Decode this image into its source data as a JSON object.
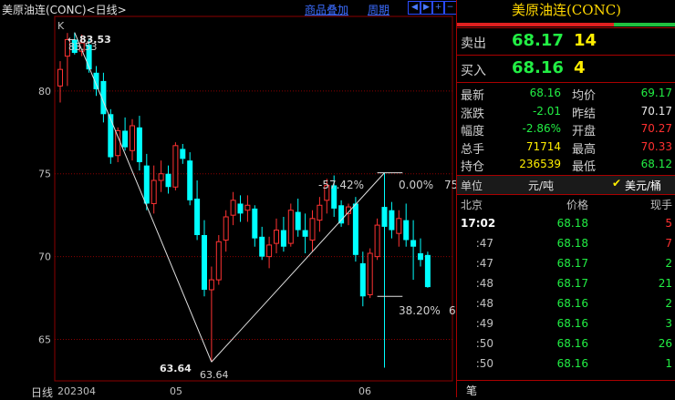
{
  "topbar": {
    "title": "美原油连(CONC)<日线>",
    "overlay_link": "商品叠加",
    "period_link": "周期",
    "buttons": [
      "arrow-left-icon",
      "arrow-right-icon",
      "plus-icon",
      "minus-icon"
    ]
  },
  "chart_marker": "K",
  "bottom_labels": {
    "period": "日线",
    "dates": [
      "202304",
      "05",
      "06"
    ]
  },
  "chart_data": {
    "type": "candlestick",
    "ylim": [
      62.5,
      84.5
    ],
    "yticks": [
      65,
      70,
      75,
      80
    ],
    "candles": [
      {
        "o": 80.3,
        "h": 81.8,
        "l": 79.3,
        "c": 81.3,
        "dir": "up"
      },
      {
        "o": 82.1,
        "h": 83.5,
        "l": 80.3,
        "c": 83.1,
        "dir": "up"
      },
      {
        "o": 83.1,
        "h": 83.53,
        "l": 82.2,
        "c": 82.3,
        "dir": "down"
      },
      {
        "o": 82.4,
        "h": 83.4,
        "l": 82.1,
        "c": 82.9,
        "dir": "up"
      },
      {
        "o": 82.8,
        "h": 83.1,
        "l": 81.1,
        "c": 81.3,
        "dir": "down"
      },
      {
        "o": 81.1,
        "h": 81.5,
        "l": 79.7,
        "c": 80.1,
        "dir": "down"
      },
      {
        "o": 80.6,
        "h": 81.1,
        "l": 78.1,
        "c": 78.6,
        "dir": "down"
      },
      {
        "o": 78.6,
        "h": 78.9,
        "l": 75.6,
        "c": 76.0,
        "dir": "down"
      },
      {
        "o": 76.1,
        "h": 77.8,
        "l": 75.7,
        "c": 77.6,
        "dir": "up"
      },
      {
        "o": 77.6,
        "h": 78.4,
        "l": 76.4,
        "c": 76.6,
        "dir": "down"
      },
      {
        "o": 76.4,
        "h": 78.3,
        "l": 75.8,
        "c": 77.9,
        "dir": "up"
      },
      {
        "o": 77.8,
        "h": 78.5,
        "l": 75.2,
        "c": 75.7,
        "dir": "down"
      },
      {
        "o": 75.5,
        "h": 76.2,
        "l": 72.8,
        "c": 73.2,
        "dir": "down"
      },
      {
        "o": 73.2,
        "h": 75.5,
        "l": 72.6,
        "c": 74.6,
        "dir": "up"
      },
      {
        "o": 74.6,
        "h": 75.8,
        "l": 73.9,
        "c": 75.0,
        "dir": "up"
      },
      {
        "o": 75.0,
        "h": 75.5,
        "l": 73.8,
        "c": 74.2,
        "dir": "down"
      },
      {
        "o": 74.2,
        "h": 76.9,
        "l": 74.0,
        "c": 76.7,
        "dir": "up"
      },
      {
        "o": 76.5,
        "h": 76.8,
        "l": 75.6,
        "c": 75.9,
        "dir": "down"
      },
      {
        "o": 75.8,
        "h": 76.3,
        "l": 73.1,
        "c": 73.4,
        "dir": "down"
      },
      {
        "o": 73.5,
        "h": 74.6,
        "l": 71.0,
        "c": 71.3,
        "dir": "down"
      },
      {
        "o": 71.3,
        "h": 72.2,
        "l": 67.6,
        "c": 68.0,
        "dir": "down"
      },
      {
        "o": 68.0,
        "h": 69.4,
        "l": 63.64,
        "c": 68.6,
        "dir": "up"
      },
      {
        "o": 68.6,
        "h": 71.3,
        "l": 68.3,
        "c": 70.9,
        "dir": "up"
      },
      {
        "o": 71.0,
        "h": 72.8,
        "l": 70.3,
        "c": 72.4,
        "dir": "up"
      },
      {
        "o": 72.5,
        "h": 73.9,
        "l": 71.9,
        "c": 73.4,
        "dir": "up"
      },
      {
        "o": 73.2,
        "h": 73.7,
        "l": 72.1,
        "c": 72.6,
        "dir": "down"
      },
      {
        "o": 72.8,
        "h": 73.7,
        "l": 72.1,
        "c": 73.1,
        "dir": "up"
      },
      {
        "o": 72.9,
        "h": 73.1,
        "l": 70.6,
        "c": 71.1,
        "dir": "down"
      },
      {
        "o": 71.2,
        "h": 71.8,
        "l": 69.8,
        "c": 70.0,
        "dir": "down"
      },
      {
        "o": 70.0,
        "h": 71.2,
        "l": 69.3,
        "c": 70.7,
        "dir": "up"
      },
      {
        "o": 70.8,
        "h": 72.3,
        "l": 70.2,
        "c": 71.6,
        "dir": "up"
      },
      {
        "o": 71.6,
        "h": 72.4,
        "l": 70.3,
        "c": 70.6,
        "dir": "down"
      },
      {
        "o": 70.8,
        "h": 73.2,
        "l": 70.6,
        "c": 72.8,
        "dir": "up"
      },
      {
        "o": 72.7,
        "h": 73.5,
        "l": 71.2,
        "c": 71.6,
        "dir": "down"
      },
      {
        "o": 71.6,
        "h": 72.6,
        "l": 70.2,
        "c": 71.2,
        "dir": "down"
      },
      {
        "o": 71.0,
        "h": 72.8,
        "l": 70.3,
        "c": 72.3,
        "dir": "up"
      },
      {
        "o": 72.2,
        "h": 73.6,
        "l": 71.5,
        "c": 73.1,
        "dir": "up"
      },
      {
        "o": 73.4,
        "h": 74.7,
        "l": 72.6,
        "c": 74.3,
        "dir": "up"
      },
      {
        "o": 74.3,
        "h": 74.9,
        "l": 72.4,
        "c": 72.9,
        "dir": "down"
      },
      {
        "o": 73.1,
        "h": 73.4,
        "l": 71.8,
        "c": 72.0,
        "dir": "down"
      },
      {
        "o": 72.6,
        "h": 73.2,
        "l": 71.9,
        "c": 73.0,
        "dir": "up"
      },
      {
        "o": 73.2,
        "h": 73.6,
        "l": 69.7,
        "c": 70.1,
        "dir": "down"
      },
      {
        "o": 69.6,
        "h": 70.3,
        "l": 67.0,
        "c": 67.6,
        "dir": "down"
      },
      {
        "o": 67.7,
        "h": 70.5,
        "l": 67.5,
        "c": 70.2,
        "dir": "up"
      },
      {
        "o": 70.0,
        "h": 72.3,
        "l": 69.8,
        "c": 71.9,
        "dir": "up"
      },
      {
        "o": 71.8,
        "h": 75.06,
        "l": 63.3,
        "c": 73.0,
        "dir": "down"
      },
      {
        "o": 72.8,
        "h": 73.3,
        "l": 71.1,
        "c": 71.6,
        "dir": "down"
      },
      {
        "o": 71.4,
        "h": 72.8,
        "l": 70.6,
        "c": 72.3,
        "dir": "up"
      },
      {
        "o": 72.2,
        "h": 73.2,
        "l": 70.6,
        "c": 71.0,
        "dir": "down"
      },
      {
        "o": 71.0,
        "h": 72.2,
        "l": 68.6,
        "c": 70.6,
        "dir": "down"
      },
      {
        "o": 70.2,
        "h": 71.1,
        "l": 69.4,
        "c": 69.8,
        "dir": "down"
      },
      {
        "o": 70.1,
        "h": 70.3,
        "l": 68.12,
        "c": 68.16,
        "dir": "down"
      }
    ],
    "fib_labels": {
      "top_bold": "83.53",
      "top_overlap": "83.53",
      "low_bold": "63.64",
      "low_plain": "63.64",
      "pct_a": "-57.42%",
      "pct_zero": "0.00%",
      "pct_b": "38.20%",
      "right_75": "75",
      "right_6": "6"
    },
    "lines": [
      {
        "from": [
          2,
          83.53
        ],
        "to": [
          21,
          63.64
        ]
      },
      {
        "from": [
          21,
          63.64
        ],
        "to": [
          45,
          75.06
        ]
      }
    ]
  },
  "panel": {
    "name": "美原油连(CONC)",
    "ask": {
      "label": "卖出",
      "price": "68.17",
      "vol": "14"
    },
    "bid": {
      "label": "买入",
      "price": "68.16",
      "vol": "4"
    },
    "stats": [
      {
        "l": "最新",
        "v": "68.16",
        "vc": "g",
        "l2": "均价",
        "v2": "69.17",
        "vc2": "g"
      },
      {
        "l": "涨跌",
        "v": "-2.01",
        "vc": "g",
        "l2": "昨结",
        "v2": "70.17",
        "vc2": "w"
      },
      {
        "l": "幅度",
        "v": "-2.86%",
        "vc": "g",
        "l2": "开盘",
        "v2": "70.27",
        "vc2": "r"
      },
      {
        "l": "总手",
        "v": "71714",
        "vc": "y",
        "l2": "最高",
        "v2": "70.33",
        "vc2": "r"
      },
      {
        "l": "持仓",
        "v": "236539",
        "vc": "y",
        "l2": "最低",
        "v2": "68.12",
        "vc2": "g"
      }
    ],
    "unit_label": "单位",
    "unit_a": "元/吨",
    "unit_b": "美元/桶",
    "tick_header": {
      "t": "北京",
      "p": "价格",
      "v": "现手"
    },
    "ticks": [
      {
        "t": "17:02",
        "p": "68.18",
        "v": "5",
        "vc": "r",
        "bold": true
      },
      {
        "t": ":47",
        "p": "68.18",
        "v": "7",
        "vc": "r"
      },
      {
        "t": ":47",
        "p": "68.17",
        "v": "2",
        "vc": "g"
      },
      {
        "t": ":48",
        "p": "68.17",
        "v": "21",
        "vc": "g"
      },
      {
        "t": ":48",
        "p": "68.16",
        "v": "2",
        "vc": "g"
      },
      {
        "t": ":49",
        "p": "68.16",
        "v": "3",
        "vc": "g"
      },
      {
        "t": ":50",
        "p": "68.16",
        "v": "26",
        "vc": "g"
      },
      {
        "t": ":50",
        "p": "68.16",
        "v": "1",
        "vc": "g"
      }
    ],
    "tab_label": "笔"
  },
  "colors": {
    "up": "#ff3232",
    "down": "#00ffff",
    "bg": "#000000",
    "grid": "#8b0000"
  }
}
